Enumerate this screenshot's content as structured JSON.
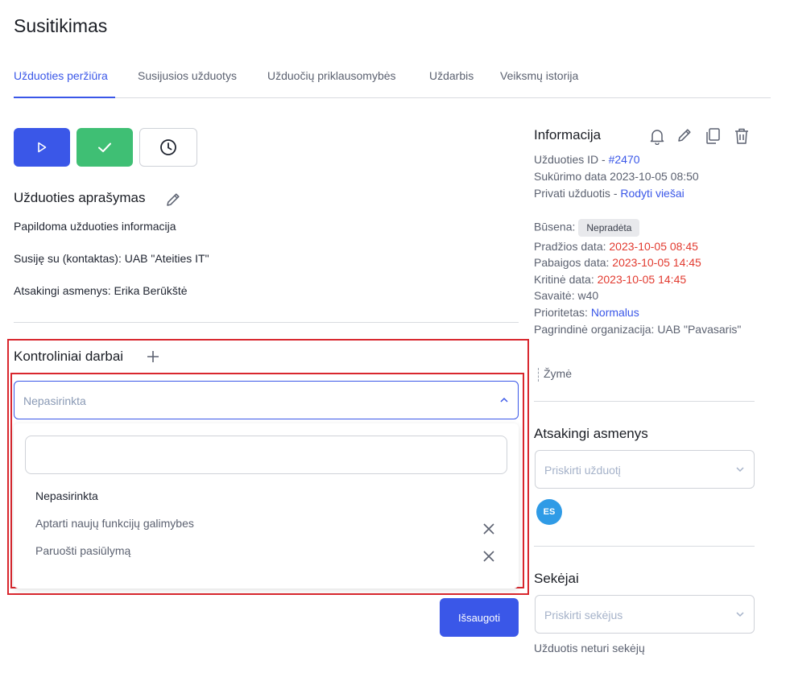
{
  "page": {
    "title": "Susitikimas"
  },
  "tabs": [
    {
      "label": "Užduoties peržiūra",
      "active": true
    },
    {
      "label": "Susijusios užduotys"
    },
    {
      "label": "Užduočių priklausomybės"
    },
    {
      "label": "Uždarbis"
    },
    {
      "label": "Veiksmų istorija"
    }
  ],
  "action_buttons": [
    {
      "icon": "play-icon",
      "color": "#3a57e8"
    },
    {
      "icon": "check-icon",
      "color": "#3fbf74"
    },
    {
      "icon": "clock-icon",
      "color": "#ffffff"
    }
  ],
  "description": {
    "title": "Užduoties aprašymas",
    "text": "Papildoma užduoties informacija",
    "related": "Susiję su (kontaktas): UAB \"Ateities IT\"",
    "responsible": "Atsakingi asmenys: Erika Berūkštė"
  },
  "checklist": {
    "title": "Kontroliniai darbai",
    "select_placeholder": "Nepasirinkta",
    "search_value": "",
    "options": [
      {
        "label": "Nepasirinkta",
        "removable": false
      },
      {
        "label": "Aptarti naujų funkcijų galimybes",
        "removable": true
      },
      {
        "label": "Paruošti pasiūlymą",
        "removable": true
      }
    ]
  },
  "save_label": "Išsaugoti",
  "info": {
    "title": "Informacija",
    "id_label": "Užduoties ID - ",
    "id_value": "#2470",
    "created": "Sukūrimo data 2023-10-05 08:50",
    "private_label": "Privati užduotis - ",
    "private_link": "Rodyti viešai",
    "status_label": "Būsena:",
    "status_value": "Nepradėta",
    "start_label": "Pradžios data: ",
    "start_value": "2023-10-05 08:45",
    "end_label": "Pabaigos data: ",
    "end_value": "2023-10-05 14:45",
    "critical_label": "Kritinė data: ",
    "critical_value": "2023-10-05 14:45",
    "week": "Savaitė: w40",
    "priority_label": "Prioritetas: ",
    "priority_value": "Normalus",
    "org": "Pagrindinė organizacija: UAB \"Pavasaris\"",
    "tag_label": "Žymė"
  },
  "responsible": {
    "title": "Atsakingi asmenys",
    "placeholder": "Priskirti užduotį",
    "avatar_initials": "ES"
  },
  "followers": {
    "title": "Sekėjai",
    "placeholder": "Priskirti sekėjus",
    "empty_text": "Užduotis neturi sekėjų"
  },
  "colors": {
    "accent": "#3a57e8",
    "success": "#3fbf74",
    "danger": "#e23a2f",
    "highlight": "#d9272e"
  }
}
